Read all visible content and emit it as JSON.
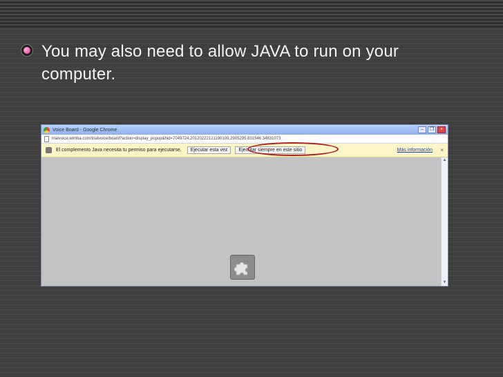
{
  "slide": {
    "bullet_text": "You may also need to allow JAVA to run on your computer."
  },
  "browser": {
    "window_title": "Voice Board - Google Chrome",
    "url": "trialvoice.wimba.com/trialvoice/board?action=display_popup&hid=7049724,20120222121190109,2905295.831546.34831073",
    "infobar": {
      "message": "El complemento Java necesita tu permiso para ejecutarse.",
      "run_once_button": "Ejecutar esta vez",
      "always_run_button": "Ejecutar siempre en este sitio",
      "more_info_link": "Más información",
      "close_glyph": "×"
    },
    "window_controls": {
      "minimize": "–",
      "maximize": "❐",
      "close": "×"
    },
    "plugin_placeholder_icon": "puzzle-piece-icon"
  },
  "colors": {
    "background": "#3f3f3f",
    "bullet_accent": "#e0358f",
    "highlight_oval": "#b21a1a",
    "infobar": "#fbf5c8"
  }
}
